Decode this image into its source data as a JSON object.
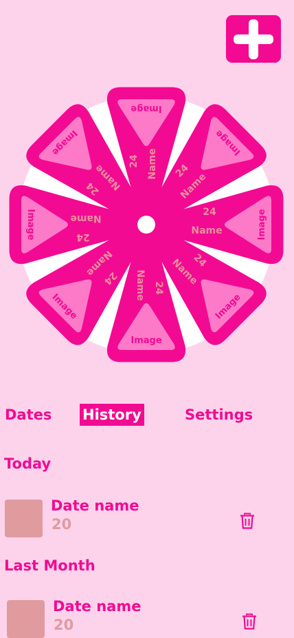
{
  "header": {
    "add_button_icon": "plus-icon"
  },
  "wheel": {
    "wedges": [
      {
        "name": "Name",
        "value": "24",
        "image_label": "Image"
      },
      {
        "name": "Name",
        "value": "24",
        "image_label": "Image"
      },
      {
        "name": "Name",
        "value": "24",
        "image_label": "Image"
      },
      {
        "name": "Name",
        "value": "24",
        "image_label": "Image"
      },
      {
        "name": "Name",
        "value": "24",
        "image_label": "Image"
      },
      {
        "name": "Name",
        "value": "24",
        "image_label": "Image"
      },
      {
        "name": "Name",
        "value": "24",
        "image_label": "Image"
      },
      {
        "name": "Name",
        "value": "24",
        "image_label": "Image"
      }
    ],
    "colors": {
      "wedge": "#f30a92",
      "inner": "#fd7ac8",
      "disc": "#ffffff"
    }
  },
  "tabs": [
    {
      "label": "Dates",
      "active": false
    },
    {
      "label": "History",
      "active": true
    },
    {
      "label": "Settings",
      "active": false
    }
  ],
  "sections": [
    {
      "heading": "Today",
      "items": [
        {
          "name": "Date name",
          "value": "20",
          "delete_icon": "trash-icon"
        }
      ]
    },
    {
      "heading": "Last Month",
      "items": [
        {
          "name": "Date name",
          "value": "20",
          "delete_icon": "trash-icon"
        }
      ]
    }
  ],
  "colors": {
    "background": "#fdd3ec",
    "accent": "#f30a92",
    "muted": "#e09b9f"
  }
}
